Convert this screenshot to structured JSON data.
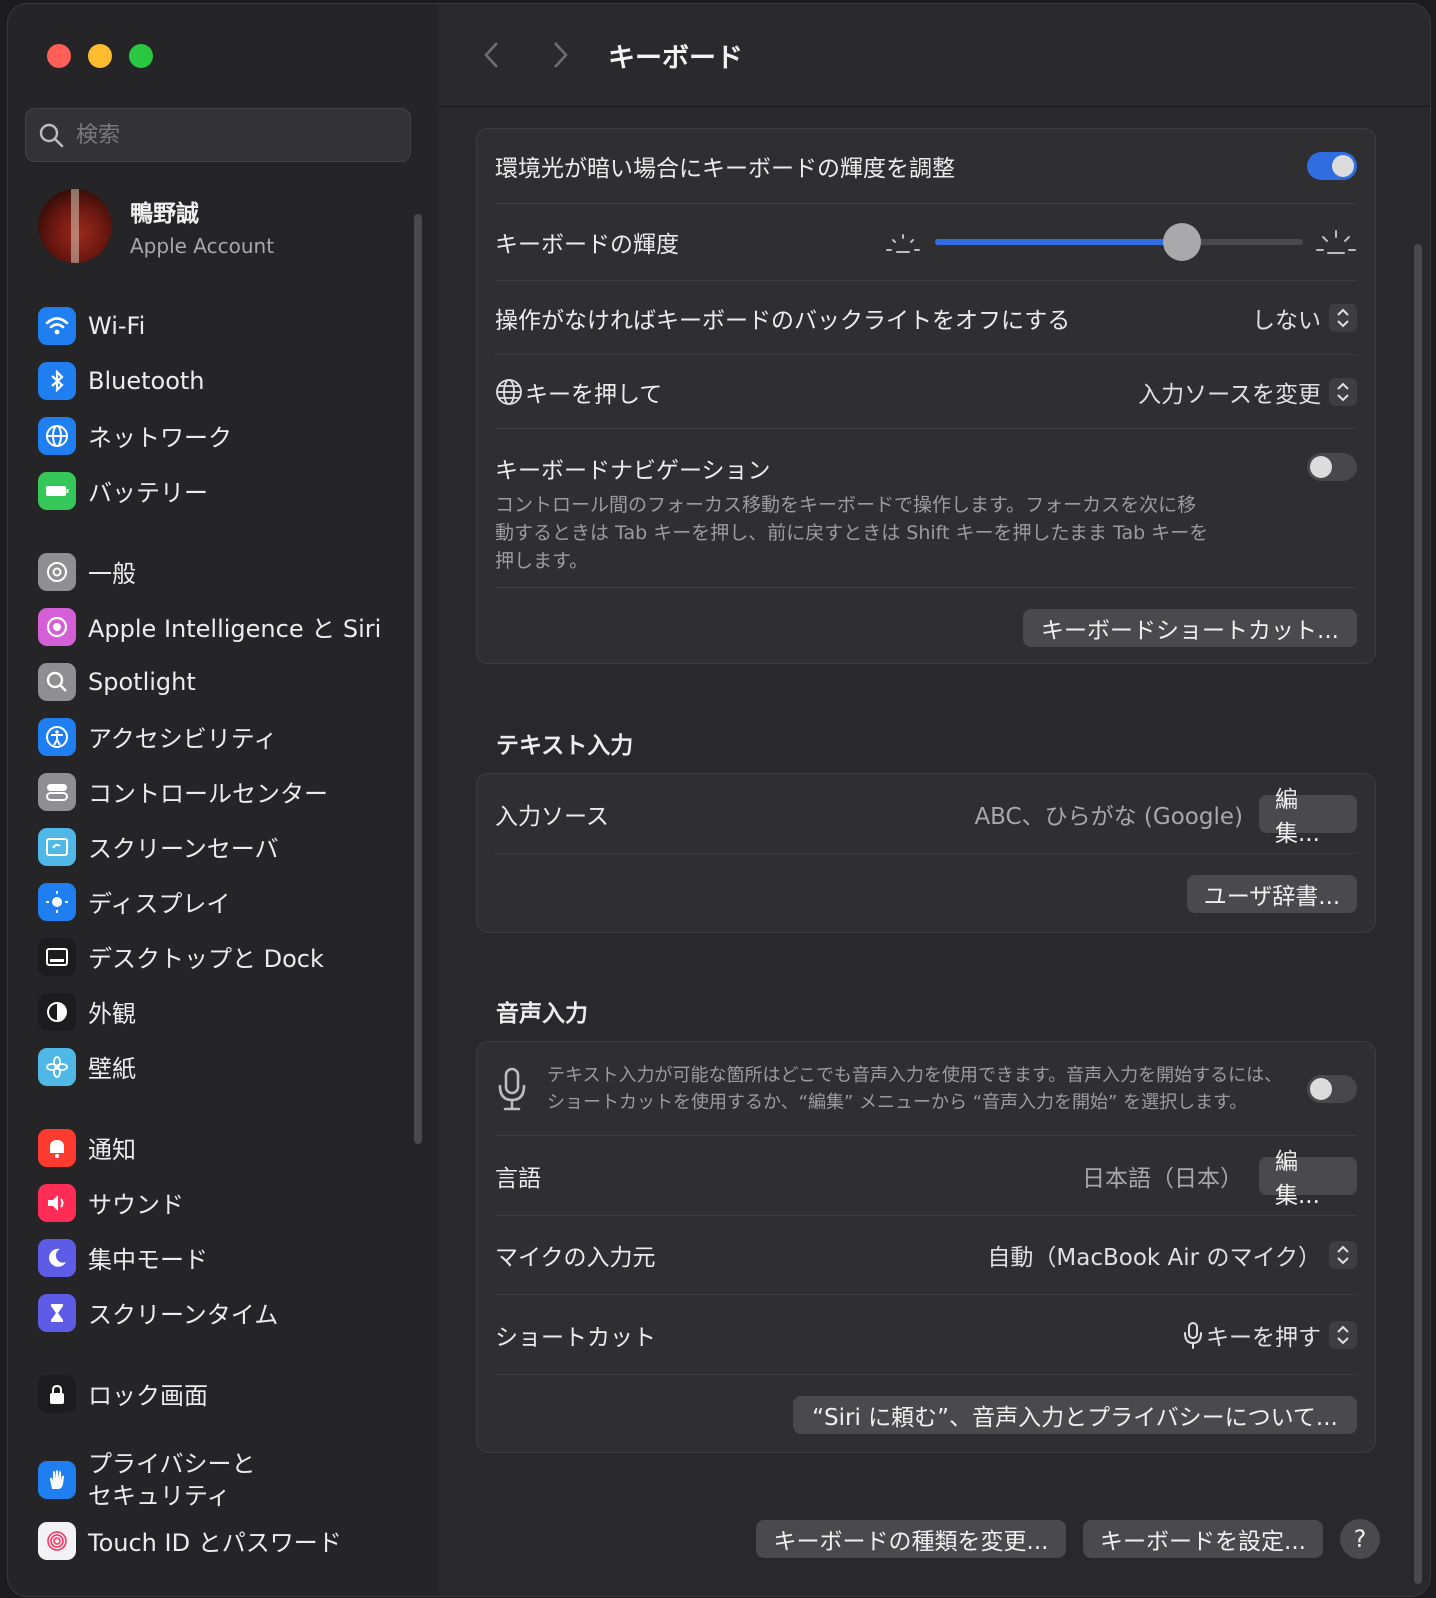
{
  "search": {
    "placeholder": "検索"
  },
  "account": {
    "name": "鴨野誠",
    "subtitle": "Apple Account"
  },
  "sidebar": {
    "items": [
      {
        "label": "Wi-Fi",
        "icon": "wifi-icon",
        "color": "#1f7ef0"
      },
      {
        "label": "Bluetooth",
        "icon": "bluetooth-icon",
        "color": "#1f7ef0"
      },
      {
        "label": "ネットワーク",
        "icon": "globe-icon",
        "color": "#1f7ef0"
      },
      {
        "label": "バッテリー",
        "icon": "battery-icon",
        "color": "#36c759"
      },
      {
        "label": "一般",
        "icon": "gear-icon",
        "color": "#8e8e93"
      },
      {
        "label": "Apple Intelligence と Siri",
        "icon": "siri-icon",
        "color": "#d45fd6"
      },
      {
        "label": "Spotlight",
        "icon": "magnifier-icon",
        "color": "#8e8e93"
      },
      {
        "label": "アクセシビリティ",
        "icon": "accessibility-icon",
        "color": "#1f7ef0"
      },
      {
        "label": "コントロールセンター",
        "icon": "toggles-icon",
        "color": "#8e8e93"
      },
      {
        "label": "スクリーンセーバ",
        "icon": "screensaver-icon",
        "color": "#4fb8e6"
      },
      {
        "label": "ディスプレイ",
        "icon": "sun-icon",
        "color": "#1f7ef0"
      },
      {
        "label": "デスクトップと Dock",
        "icon": "dock-icon",
        "color": "#1c1c1e"
      },
      {
        "label": "外観",
        "icon": "appearance-icon",
        "color": "#1c1c1e"
      },
      {
        "label": "壁紙",
        "icon": "flower-icon",
        "color": "#4fb8e6"
      },
      {
        "label": "通知",
        "icon": "bell-icon",
        "color": "#ff3b30"
      },
      {
        "label": "サウンド",
        "icon": "speaker-icon",
        "color": "#ff2d55"
      },
      {
        "label": "集中モード",
        "icon": "moon-icon",
        "color": "#5e5ce6"
      },
      {
        "label": "スクリーンタイム",
        "icon": "hourglass-icon",
        "color": "#5e5ce6"
      },
      {
        "label": "ロック画面",
        "icon": "lock-icon",
        "color": "#1c1c1e"
      },
      {
        "label": "プライバシーと\nセキュリティ",
        "icon": "hand-icon",
        "color": "#1f7ef0"
      },
      {
        "label": "Touch ID とパスワード",
        "icon": "fingerprint-icon",
        "color": "#f2f2f7"
      }
    ]
  },
  "header": {
    "title": "キーボード"
  },
  "backlight": {
    "auto_label": "環境光が暗い場合にキーボードの輝度を調整",
    "auto_on": true,
    "brightness_label": "キーボードの輝度",
    "brightness_level": 0.67,
    "timeout_label": "操作がなければキーボードのバックライトをオフにする",
    "timeout_value": "しない",
    "globe_label": "キーを押して",
    "globe_value": "入力ソースを変更",
    "nav_label": "キーボードナビゲーション",
    "nav_on": false,
    "nav_desc": "コントロール間のフォーカス移動をキーボードで操作します。フォーカスを次に移動するときは Tab キーを押し、前に戻すときは Shift キーを押したまま Tab キーを押します。",
    "shortcuts_button": "キーボードショートカット..."
  },
  "text_input": {
    "section_title": "テキスト入力",
    "sources_label": "入力ソース",
    "sources_value": "ABC、ひらがな (Google)",
    "edit_button": "編集...",
    "dictionary_button": "ユーザ辞書..."
  },
  "dictation": {
    "section_title": "音声入力",
    "desc": "テキスト入力が可能な箇所はどこでも音声入力を使用できます。音声入力を開始するには、ショートカットを使用するか、“編集” メニューから “音声入力を開始” を選択します。",
    "enabled": false,
    "language_label": "言語",
    "language_value": "日本語（日本）",
    "edit_button": "編集...",
    "mic_label": "マイクの入力元",
    "mic_value": "自動（MacBook Air のマイク）",
    "shortcut_label": "ショートカット",
    "shortcut_value": "キーを押す",
    "privacy_button": "“Siri に頼む”、音声入力とプライバシーについて..."
  },
  "footer": {
    "change_type_button": "キーボードの種類を変更...",
    "setup_button": "キーボードを設定...",
    "help_button": "?"
  },
  "colors": {
    "accent": "#2f6de0"
  }
}
